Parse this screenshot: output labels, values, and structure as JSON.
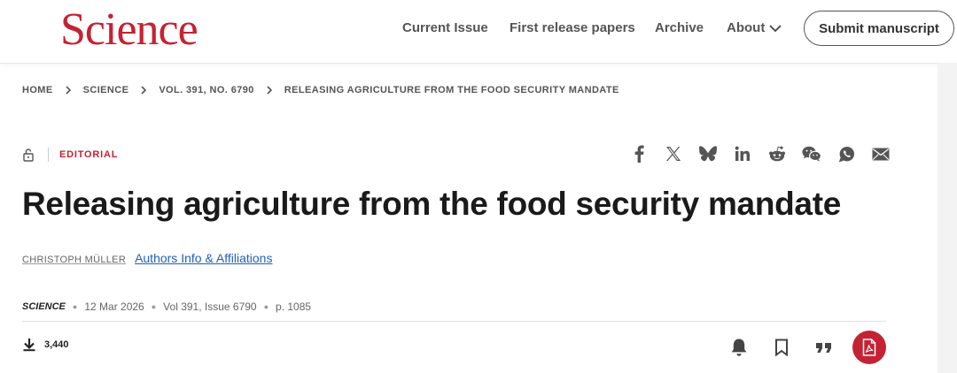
{
  "header": {
    "logo_text": "Science",
    "nav": [
      "Current Issue",
      "First release papers",
      "Archive",
      "About"
    ],
    "submit_label": "Submit manuscript"
  },
  "breadcrumb": [
    "HOME",
    "SCIENCE",
    "VOL. 391, NO. 6790",
    "RELEASING AGRICULTURE FROM THE FOOD SECURITY MANDATE"
  ],
  "article": {
    "topic": "EDITORIAL",
    "title": "Releasing agriculture from the food security mandate",
    "author": "CHRISTOPH MÜLLER",
    "affiliations_link": "Authors Info & Affiliations",
    "journal": "SCIENCE",
    "date": "12 Mar 2026",
    "volume_issue": "Vol 391, Issue 6790",
    "page": "p. 1085",
    "downloads": "3,440"
  },
  "share_icons": [
    "facebook-icon",
    "x-icon",
    "bluesky-icon",
    "linkedin-icon",
    "reddit-icon",
    "wechat-icon",
    "whatsapp-icon",
    "email-icon"
  ],
  "action_icons": [
    "bell-icon",
    "bookmark-icon",
    "quote-icon",
    "pdf-icon"
  ],
  "colors": {
    "brand": "#c52233",
    "link": "#1f5fb8",
    "text": "#1a1a1a"
  }
}
